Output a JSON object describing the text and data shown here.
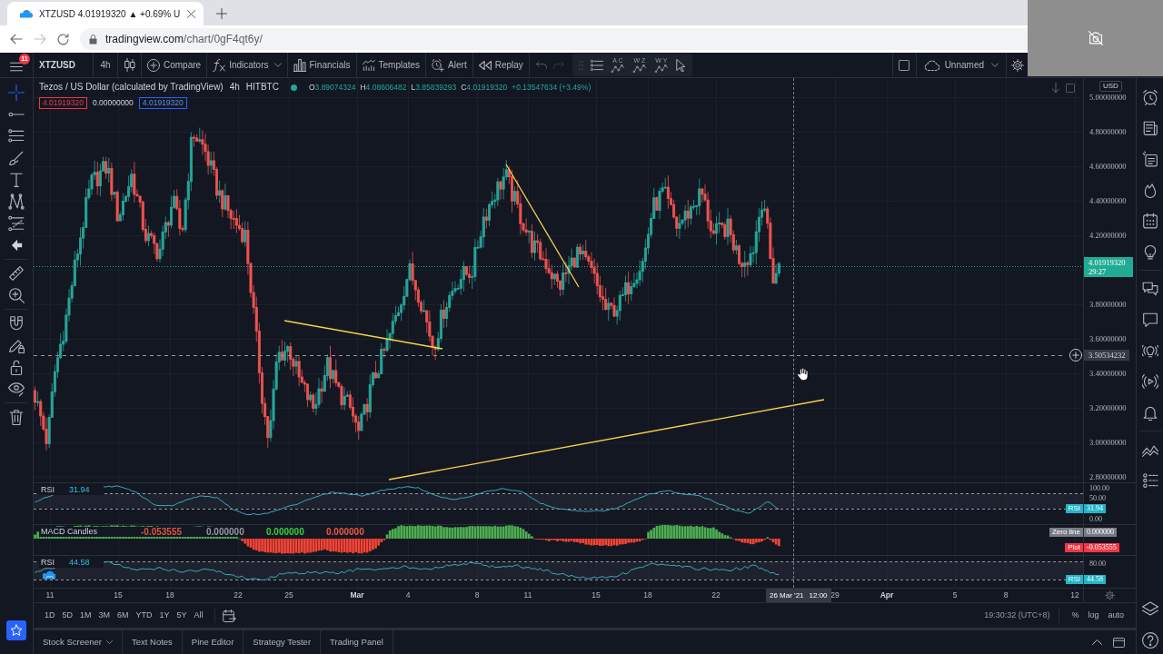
{
  "browser": {
    "tab_title": "XTZUSD 4.01919320 ▲ +0.69% U",
    "url_host": "tradingview.com",
    "url_path": "/chart/0gF4qt6y/"
  },
  "toolbar": {
    "notifications": "11",
    "symbol": "XTZUSD",
    "interval": "4h",
    "items": [
      {
        "kind": "compare",
        "label": "Compare",
        "menu": false
      },
      {
        "kind": "indicators",
        "label": "Indicators",
        "menu": true
      },
      {
        "kind": "financials",
        "label": "Financials",
        "menu": false
      },
      {
        "kind": "templates",
        "label": "Templates",
        "menu": false
      },
      {
        "kind": "alert",
        "label": "Alert",
        "menu": false
      },
      {
        "kind": "replay",
        "label": "Replay",
        "menu": false
      }
    ],
    "patterns": [
      {
        "letters": "A C"
      },
      {
        "letters": "W Z"
      },
      {
        "letters": "W Y"
      }
    ],
    "layout_name": "Unnamed"
  },
  "drawing_tools": [
    {
      "tools": [
        {
          "kind": "crosshair",
          "selected": true
        },
        {
          "kind": "trend-line",
          "selected": false
        },
        {
          "kind": "channel",
          "selected": false
        },
        {
          "kind": "brush",
          "selected": false
        },
        {
          "kind": "text",
          "selected": false
        },
        {
          "kind": "pattern",
          "selected": false
        },
        {
          "kind": "fib",
          "selected": false
        },
        {
          "kind": "back",
          "selected": false
        }
      ]
    },
    {
      "tools": [
        {
          "kind": "ruler",
          "selected": false
        },
        {
          "kind": "zoom",
          "selected": false
        }
      ]
    },
    {
      "tools": [
        {
          "kind": "magnet",
          "selected": false
        },
        {
          "kind": "lock-drawing",
          "selected": false
        },
        {
          "kind": "lock",
          "selected": false
        },
        {
          "kind": "eye",
          "selected": false
        }
      ]
    },
    {
      "tools": [
        {
          "kind": "trash",
          "selected": false
        }
      ]
    }
  ],
  "legend": {
    "title": "Tezos / US Dollar (calculated by TradingView)",
    "interval": "4h",
    "exchange": "HITBTC",
    "market_open": true,
    "ohlc": [
      {
        "letter": "O",
        "value": "3.89074324"
      },
      {
        "letter": "H",
        "value": "4.08606482"
      },
      {
        "letter": "L",
        "value": "3.85839293"
      },
      {
        "letter": "C",
        "value": "4.01919320"
      }
    ],
    "change": "+0.13547634 (+3.49%)",
    "quotes": [
      {
        "kind": "sell",
        "value": "4.01919320"
      },
      {
        "kind": "spread",
        "value": "0.00000000"
      },
      {
        "kind": "buy",
        "value": "4.01919320"
      }
    ]
  },
  "price_axis": {
    "currency": "USD",
    "labels": [
      "5.00000000",
      "4.80000000",
      "4.60000000",
      "4.40000000",
      "4.20000000",
      "3.80000000",
      "3.60000000",
      "3.40000000",
      "3.20000000",
      "3.00000000",
      "2.80000000"
    ],
    "last_price": "4.01919320",
    "countdown": "29:27",
    "crosshair_price": "3.50534232"
  },
  "panes": [
    {
      "kind": "rsi",
      "title": "RSI",
      "value": "31.94",
      "axis": [
        {
          "kind": "label",
          "text": "100.00"
        },
        {
          "kind": "label",
          "text": "50.00"
        },
        {
          "kind": "tag",
          "label": "RSI",
          "value": "31.94"
        },
        {
          "kind": "label",
          "text": "0.00"
        }
      ]
    },
    {
      "kind": "macd",
      "title": "MACD Candles",
      "values": [
        {
          "text": "-0.053555",
          "color": "#e0533f"
        },
        {
          "text": "0.000000",
          "color": "#9598a1"
        },
        {
          "text": "0.000000",
          "color": "#33d13a"
        },
        {
          "text": "0.000000",
          "color": "#f0573c"
        }
      ],
      "axis": [
        {
          "kind": "tag",
          "label": "Zero line",
          "value": "0.000000",
          "color": "#787b86"
        },
        {
          "kind": "tag",
          "label": "Plot",
          "value": "-0.053555",
          "color": "#f23645"
        }
      ]
    },
    {
      "kind": "rsi",
      "title": "RSI",
      "value": "44.58",
      "cloud_badge": true,
      "axis": [
        {
          "kind": "label",
          "text": "80.00"
        },
        {
          "kind": "tag",
          "label": "RSI",
          "value": "44.58"
        }
      ]
    }
  ],
  "time_axis": {
    "labels": [
      {
        "text": "11",
        "kind": "day"
      },
      {
        "text": "15",
        "kind": "day"
      },
      {
        "text": "18",
        "kind": "day"
      },
      {
        "text": "22",
        "kind": "day"
      },
      {
        "text": "25",
        "kind": "day"
      },
      {
        "text": "Mar",
        "kind": "month"
      },
      {
        "text": "4",
        "kind": "day"
      },
      {
        "text": "8",
        "kind": "day"
      },
      {
        "text": "11",
        "kind": "day"
      },
      {
        "text": "15",
        "kind": "day"
      },
      {
        "text": "18",
        "kind": "day"
      },
      {
        "text": "22",
        "kind": "day"
      },
      {
        "text": "29",
        "kind": "day"
      },
      {
        "text": "Apr",
        "kind": "month"
      },
      {
        "text": "5",
        "kind": "day"
      },
      {
        "text": "8",
        "kind": "day"
      },
      {
        "text": "12",
        "kind": "day"
      }
    ],
    "crosshair_date": "26 Mar '21",
    "crosshair_time": "12:00"
  },
  "range_bar": {
    "ranges": [
      "1D",
      "5D",
      "1M",
      "3M",
      "6M",
      "YTD",
      "1Y",
      "5Y",
      "All"
    ],
    "clock": "19:30:32 (UTC+8)",
    "scale_options": [
      "%",
      "log",
      "auto"
    ]
  },
  "bottom_panel": {
    "tabs": [
      {
        "label": "Stock Screener",
        "menu": true
      },
      {
        "label": "Text Notes",
        "menu": false
      },
      {
        "label": "Pine Editor",
        "menu": false
      },
      {
        "label": "Strategy Tester",
        "menu": false
      },
      {
        "label": "Trading Panel",
        "menu": false
      }
    ]
  }
}
